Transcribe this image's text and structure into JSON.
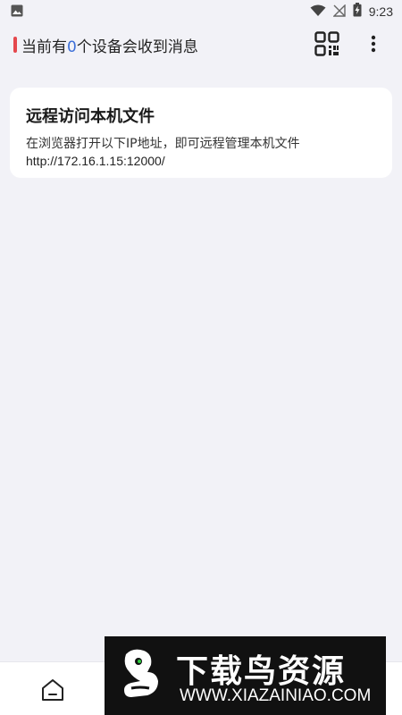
{
  "statusbar": {
    "time": "9:23",
    "icons": [
      "image-icon",
      "wifi-icon",
      "no-signal-icon",
      "battery-charging-icon"
    ]
  },
  "header": {
    "prefix": "当前有",
    "count": "0",
    "suffix": "个设备会收到消息",
    "accent_color": "#e5484d",
    "count_color": "#3c6fd8",
    "actions": [
      "qr-code-icon",
      "more-vert-icon"
    ]
  },
  "card": {
    "title": "远程访问本机文件",
    "description": "在浏览器打开以下IP地址，即可远程管理本机文件",
    "url": "http://172.16.1.15:12000/"
  },
  "bottomnav": {
    "items": [
      "home-icon"
    ]
  },
  "watermark": {
    "title": "下载鸟资源",
    "url": "WWW.XIAZAINIAO.COM"
  }
}
